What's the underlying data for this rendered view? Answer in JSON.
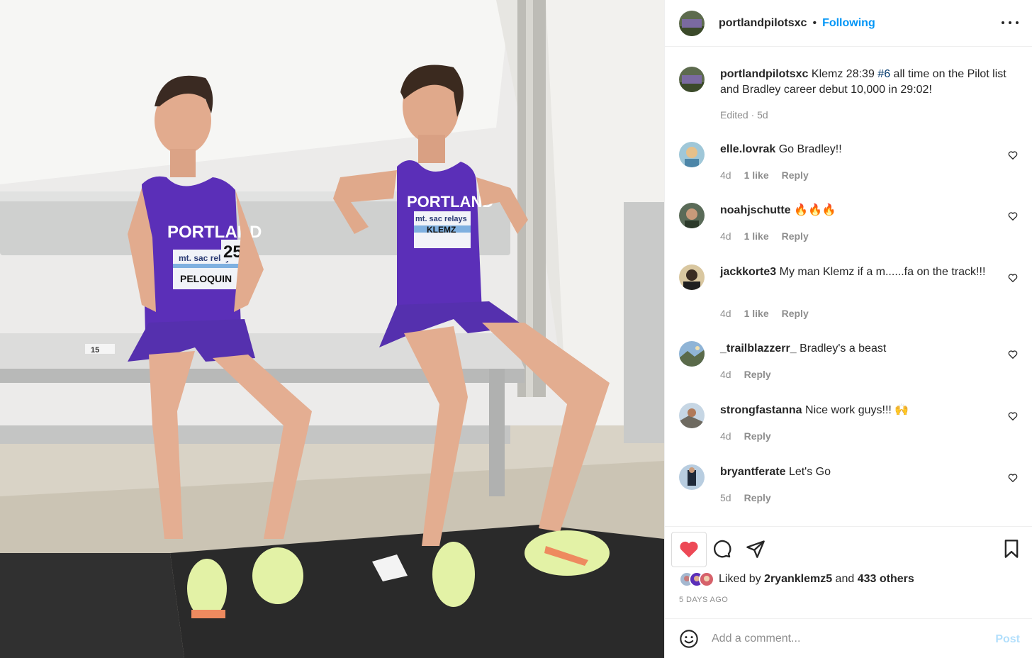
{
  "photo": {
    "bib_left_school": "PORTLAND",
    "bib_left_event": "mt. sac relays",
    "bib_left_name": "PELOQUIN",
    "bib_left_number": "25",
    "bib_right_school": "PORTLAND",
    "bib_right_event": "mt. sac relays",
    "bib_right_name": "KLEMZ",
    "bench_number": "15"
  },
  "header": {
    "username": "portlandpilotsxc",
    "separator": "•",
    "follow_status": "Following"
  },
  "caption": {
    "username": "portlandpilotsxc",
    "text_before": "Klemz 28:39 ",
    "hashtag": "#6",
    "text_after": " all time on the Pilot list and Bradley career debut 10,000 in 29:02!",
    "meta": "Edited · 5d"
  },
  "comments": [
    {
      "username": "elle.lovrak",
      "text": "Go Bradley!!",
      "age": "4d",
      "likes": "1 like",
      "reply": "Reply"
    },
    {
      "username": "noahjschutte",
      "text": "🔥🔥🔥",
      "age": "4d",
      "likes": "1 like",
      "reply": "Reply"
    },
    {
      "username": "jackkorte3",
      "text": "My man Klemz if a m......fa on the track!!!",
      "age": "4d",
      "likes": "1 like",
      "reply": "Reply"
    },
    {
      "username": "_trailblazzerr_",
      "text": "Bradley's a beast",
      "age": "4d",
      "likes": "",
      "reply": "Reply"
    },
    {
      "username": "strongfastanna",
      "text": "Nice work guys!!! 🙌",
      "age": "4d",
      "likes": "",
      "reply": "Reply"
    },
    {
      "username": "bryantferate",
      "text": "Let's Go",
      "age": "5d",
      "likes": "",
      "reply": "Reply"
    }
  ],
  "likes": {
    "prefix": "Liked by ",
    "user": "2ryanklemz5",
    "middle": " and ",
    "others": "433 others"
  },
  "time_ago": "5 DAYS AGO",
  "add_comment": {
    "placeholder": "Add a comment...",
    "post_label": "Post"
  },
  "colors": {
    "accent_blue": "#0095f6",
    "like_red": "#ed4956",
    "uniform_purple": "#5b2fb8"
  },
  "icons": [
    "more-icon",
    "heart-icon",
    "comment-icon",
    "share-icon",
    "save-icon",
    "smile-icon"
  ]
}
